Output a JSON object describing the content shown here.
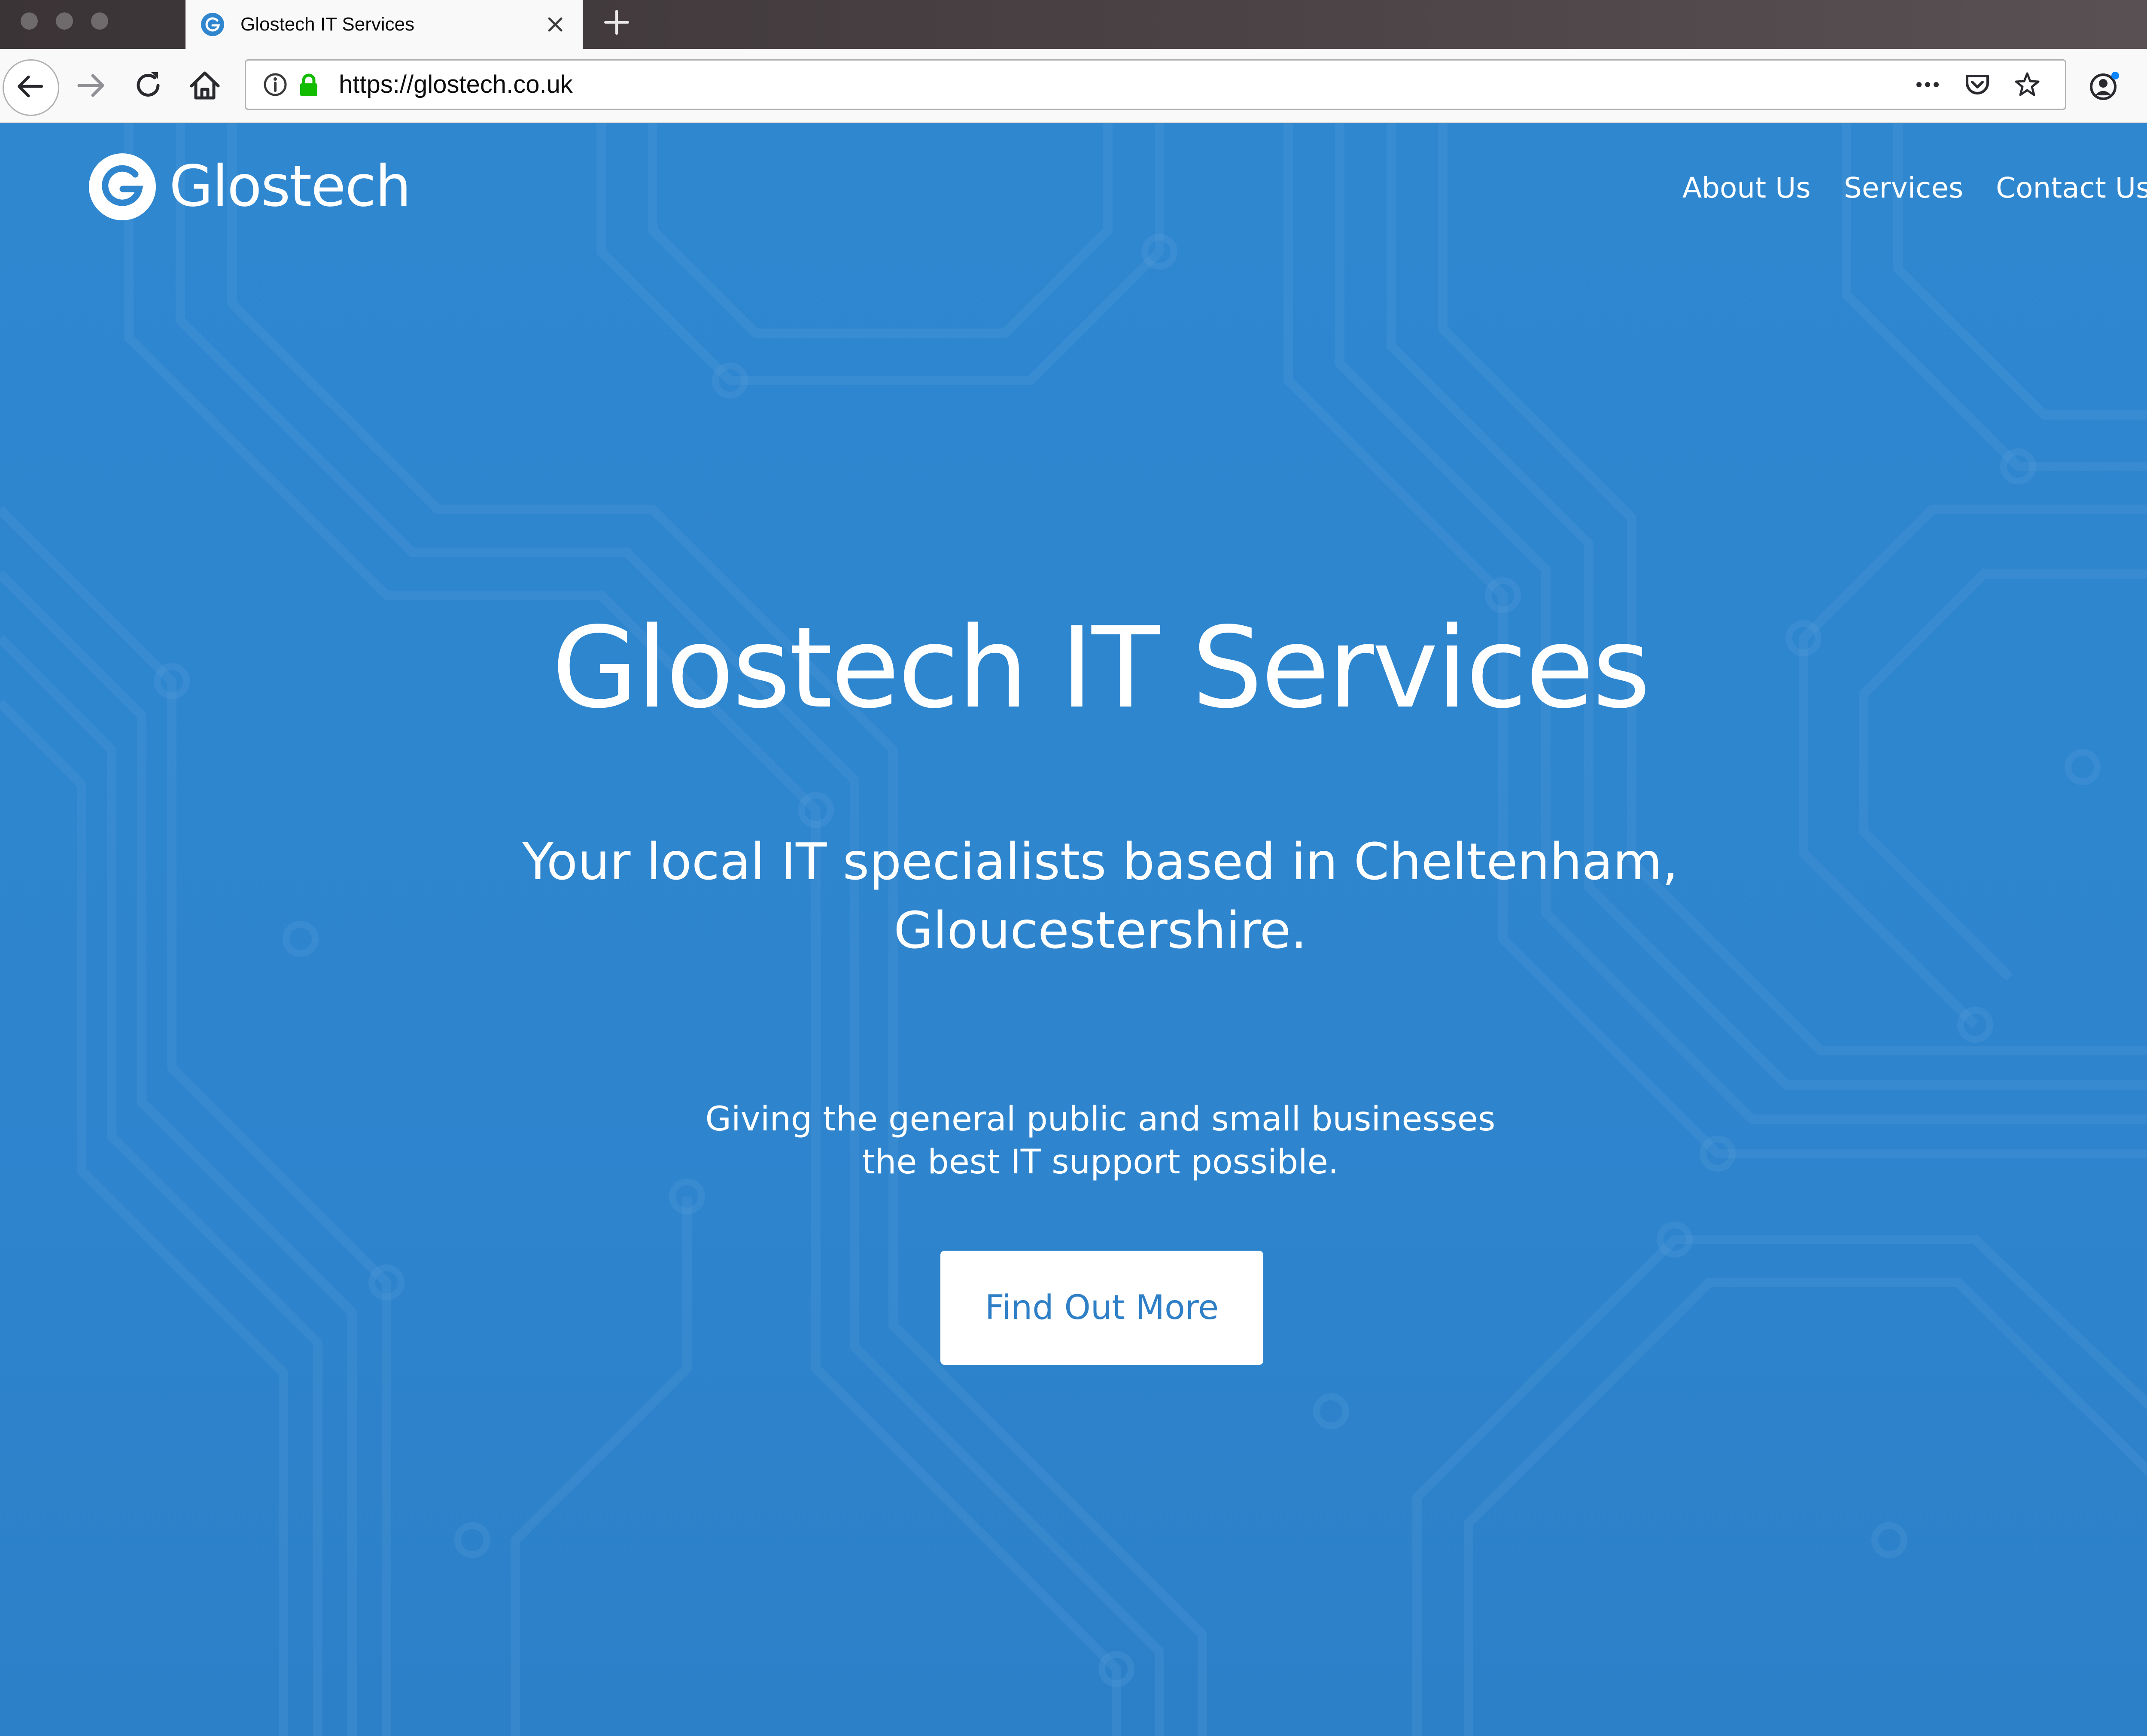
{
  "browser": {
    "tab": {
      "title": "Glostech IT Services",
      "favicon": "glostech-g-icon"
    },
    "url": "https://glostech.co.uk",
    "toolbar_icons": [
      "back-icon",
      "forward-icon",
      "reload-icon",
      "home-icon",
      "info-icon",
      "lock-icon",
      "page-actions-icon",
      "pocket-icon",
      "bookmark-star-icon",
      "account-icon",
      "menu-icon"
    ]
  },
  "site": {
    "brand": "Glostech",
    "nav": [
      "About Us",
      "Services",
      "Contact Us"
    ],
    "hero": {
      "title": "Glostech IT Services",
      "subtitle": "Your local IT specialists based in Cheltenham, Gloucestershire.",
      "description": "Giving the general public and small businesses the best IT support possible.",
      "cta": "Find Out More"
    }
  },
  "colors": {
    "accent": "#2f86cf",
    "cta_text": "#2f7fc6",
    "lock": "#12bc00"
  }
}
